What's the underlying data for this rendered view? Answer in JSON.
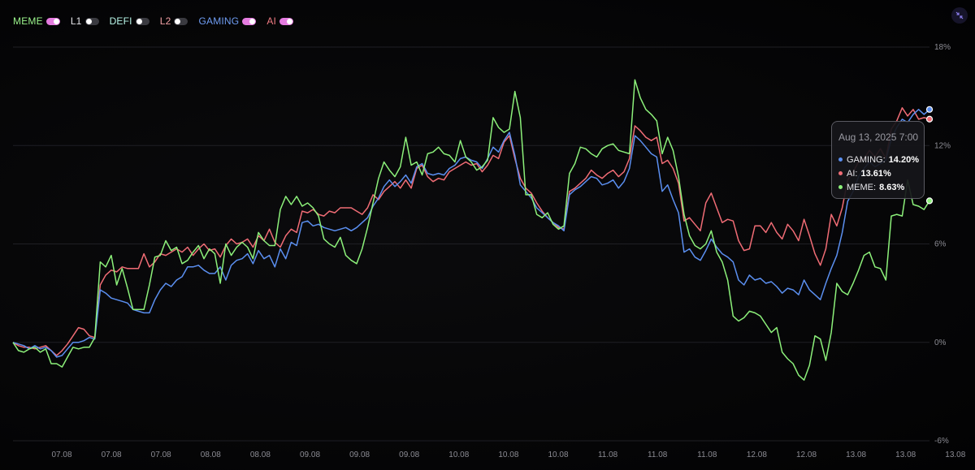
{
  "legend": {
    "items": [
      {
        "label": "MEME",
        "color": "#9bf58c",
        "enabled": true
      },
      {
        "label": "L1",
        "color": "#e4e4e8",
        "enabled": false
      },
      {
        "label": "DEFI",
        "color": "#b9f7ea",
        "enabled": false
      },
      {
        "label": "L2",
        "color": "#f2a0a4",
        "enabled": false
      },
      {
        "label": "GAMING",
        "color": "#6f9df3",
        "enabled": true
      },
      {
        "label": "AI",
        "color": "#f07a82",
        "enabled": true
      }
    ]
  },
  "collapse_icon": "collapse-arrows-icon",
  "tooltip": {
    "date": "Aug 13, 2025 7:00",
    "rows": [
      {
        "name": "GAMING:",
        "value": "14.20%",
        "color": "#5b8ff0"
      },
      {
        "name": "AI:",
        "value": "13.61%",
        "color": "#f06c75"
      },
      {
        "name": "MEME:",
        "value": "8.63%",
        "color": "#8cf07a"
      }
    ]
  },
  "chart_data": {
    "type": "line",
    "x_tick_labels": [
      "07.08",
      "07.08",
      "07.08",
      "08.08",
      "08.08",
      "09.08",
      "09.08",
      "09.08",
      "10.08",
      "10.08",
      "10.08",
      "11.08",
      "11.08",
      "11.08",
      "12.08",
      "12.08",
      "13.08",
      "13.08",
      "13.08"
    ],
    "y_ticks": [
      18,
      12,
      6,
      0,
      -6
    ],
    "y_tick_labels": [
      "18%",
      "12%",
      "6%",
      "0%",
      "-6%"
    ],
    "ylim": [
      -6,
      18
    ],
    "grid": true,
    "legend_position": "top-left",
    "series": [
      {
        "name": "AI",
        "color": "#f06c75",
        "values": [
          0,
          -0.2,
          -0.3,
          -0.3,
          -0.4,
          -0.3,
          -0.2,
          -0.5,
          -0.8,
          -0.5,
          -0.1,
          0.4,
          0.9,
          0.8,
          0.4,
          0.3,
          3.5,
          4.1,
          4.4,
          4.3,
          4.6,
          4.5,
          4.5,
          4.5,
          5.4,
          4.6,
          4.9,
          5.4,
          5.3,
          5.5,
          5.7,
          5.5,
          5.8,
          5.3,
          5.7,
          6.0,
          5.6,
          5.7,
          5.2,
          5.9,
          6.3,
          6.0,
          6.1,
          6.3,
          5.8,
          6.5,
          6.2,
          6.9,
          6.1,
          5.8,
          6.5,
          6.9,
          6.7,
          8.0,
          7.9,
          8.1,
          7.8,
          7.7,
          8.0,
          7.9,
          8.2,
          8.2,
          8.2,
          8.0,
          7.8,
          8.2,
          9.0,
          8.7,
          9.2,
          9.5,
          9.8,
          9.4,
          9.9,
          9.4,
          10.6,
          10.8,
          10.1,
          9.8,
          10.0,
          9.9,
          10.4,
          10.6,
          10.8,
          11.0,
          10.8,
          10.9,
          10.4,
          10.8,
          11.4,
          11.2,
          12.2,
          12.6,
          11.2,
          10.0,
          9.4,
          9.1,
          8.5,
          8.0,
          7.6,
          7.3,
          7.0,
          6.9,
          9.2,
          9.4,
          9.7,
          10.0,
          10.5,
          10.2,
          10.0,
          10.3,
          10.5,
          10.1,
          10.4,
          11.2,
          13.2,
          12.9,
          12.5,
          12.3,
          12.5,
          10.9,
          11.1,
          10.6,
          9.7,
          7.4,
          7.6,
          7.2,
          6.8,
          8.5,
          9.1,
          8.2,
          7.3,
          7.5,
          7.4,
          6.2,
          5.6,
          5.7,
          7.1,
          7.1,
          6.7,
          7.3,
          6.7,
          6.3,
          7.2,
          6.8,
          6.2,
          7.5,
          6.5,
          5.4,
          4.7,
          5.7,
          7.8,
          7.1,
          8.2,
          9.9,
          10.4,
          11.0,
          11.2,
          11.7,
          11.3,
          11.8,
          11.2,
          13.0,
          13.5,
          14.3,
          13.8,
          14.2,
          13.6,
          13.7,
          13.61
        ]
      },
      {
        "name": "GAMING",
        "color": "#5b8ff0",
        "values": [
          0,
          -0.1,
          -0.2,
          -0.4,
          -0.2,
          -0.4,
          -0.3,
          -0.5,
          -0.9,
          -0.8,
          -0.4,
          0,
          0,
          0.1,
          0.3,
          0.2,
          3.2,
          3.0,
          2.7,
          2.6,
          2.5,
          2.4,
          2.0,
          1.9,
          1.8,
          1.8,
          2.6,
          3.2,
          3.6,
          3.4,
          3.8,
          4.0,
          4.6,
          4.6,
          4.7,
          4.4,
          4.2,
          4.2,
          4.6,
          3.8,
          4.7,
          5.0,
          5.1,
          5.4,
          4.8,
          5.6,
          5.1,
          5.3,
          4.6,
          5.7,
          5.1,
          6.1,
          5.9,
          7.3,
          7.4,
          7.1,
          7.2,
          7.0,
          6.9,
          6.8,
          6.9,
          7.0,
          6.8,
          7.0,
          7.3,
          7.6,
          8.3,
          8.8,
          9.5,
          9.9,
          9.5,
          9.8,
          10.2,
          9.7,
          10.7,
          10.9,
          10.3,
          10.2,
          10.3,
          10.2,
          10.6,
          10.8,
          11.2,
          11.3,
          11.1,
          11.0,
          10.6,
          11.2,
          11.9,
          11.6,
          12.3,
          12.8,
          11.4,
          9.6,
          9.2,
          8.8,
          8.2,
          7.9,
          7.6,
          7.3,
          7.1,
          6.8,
          9.0,
          9.3,
          9.5,
          9.8,
          10.1,
          10.0,
          9.6,
          9.7,
          9.9,
          9.4,
          9.8,
          10.6,
          12.6,
          12.3,
          11.9,
          11.5,
          11.3,
          9.2,
          9.6,
          8.7,
          7.9,
          5.5,
          5.7,
          5.2,
          5.0,
          5.6,
          6.3,
          5.8,
          5.4,
          5.2,
          4.9,
          3.8,
          3.5,
          4.1,
          3.8,
          3.9,
          3.6,
          3.7,
          3.4,
          3.0,
          3.3,
          3.2,
          2.9,
          3.8,
          3.2,
          2.9,
          2.6,
          3.6,
          4.5,
          5.3,
          6.7,
          8.6,
          9.2,
          10.1,
          10.6,
          11.0,
          10.7,
          10.9,
          11.1,
          12.4,
          13.1,
          13.6,
          13.4,
          13.9,
          14.2,
          13.9,
          14.2
        ]
      },
      {
        "name": "MEME",
        "color": "#8cf07a",
        "values": [
          0,
          -0.5,
          -0.6,
          -0.4,
          -0.3,
          -0.6,
          -0.4,
          -1.3,
          -1.3,
          -1.5,
          -0.9,
          -0.3,
          -0.4,
          -0.3,
          -0.3,
          0.3,
          4.9,
          4.6,
          5.3,
          3.5,
          4.5,
          3.3,
          2.0,
          2.0,
          2.0,
          3.5,
          5.2,
          5.3,
          6.2,
          5.6,
          5.8,
          4.8,
          5.0,
          5.5,
          5.9,
          5.1,
          5.7,
          5.4,
          3.6,
          6.0,
          5.3,
          5.8,
          6.1,
          5.8,
          5.1,
          6.7,
          6.2,
          5.9,
          5.9,
          8.1,
          8.9,
          8.4,
          8.9,
          8.3,
          8.5,
          8.2,
          7.7,
          6.3,
          6.0,
          5.8,
          6.4,
          5.3,
          5.0,
          4.8,
          5.7,
          7.0,
          8.5,
          10.0,
          11.0,
          10.5,
          10.1,
          10.7,
          12.5,
          10.8,
          11.0,
          10.2,
          11.5,
          11.6,
          11.9,
          11.5,
          11.4,
          11.0,
          12.3,
          11.3,
          11.0,
          10.5,
          10.7,
          11.1,
          13.7,
          13.1,
          12.8,
          13.0,
          15.3,
          13.7,
          9.0,
          9.0,
          7.8,
          7.6,
          7.9,
          7.2,
          6.9,
          7.1,
          10.3,
          10.9,
          11.9,
          11.8,
          11.5,
          11.3,
          11.8,
          12.0,
          12.1,
          11.7,
          11.6,
          11.5,
          16.0,
          14.9,
          14.2,
          13.9,
          13.5,
          11.5,
          12.5,
          11.7,
          10.1,
          7.8,
          6.5,
          5.9,
          5.7,
          6.0,
          6.8,
          5.5,
          4.9,
          3.8,
          1.6,
          1.3,
          1.5,
          1.9,
          1.8,
          1.6,
          1.1,
          0.6,
          0.9,
          -0.6,
          -1.0,
          -1.3,
          -2.0,
          -2.3,
          -1.4,
          0.4,
          0.2,
          -1.1,
          0.6,
          3.6,
          3.1,
          2.9,
          3.6,
          4.4,
          5.3,
          5.5,
          4.6,
          4.5,
          3.8,
          7.7,
          7.8,
          7.7,
          9.9,
          8.4,
          8.3,
          8.1,
          8.63
        ]
      }
    ]
  }
}
